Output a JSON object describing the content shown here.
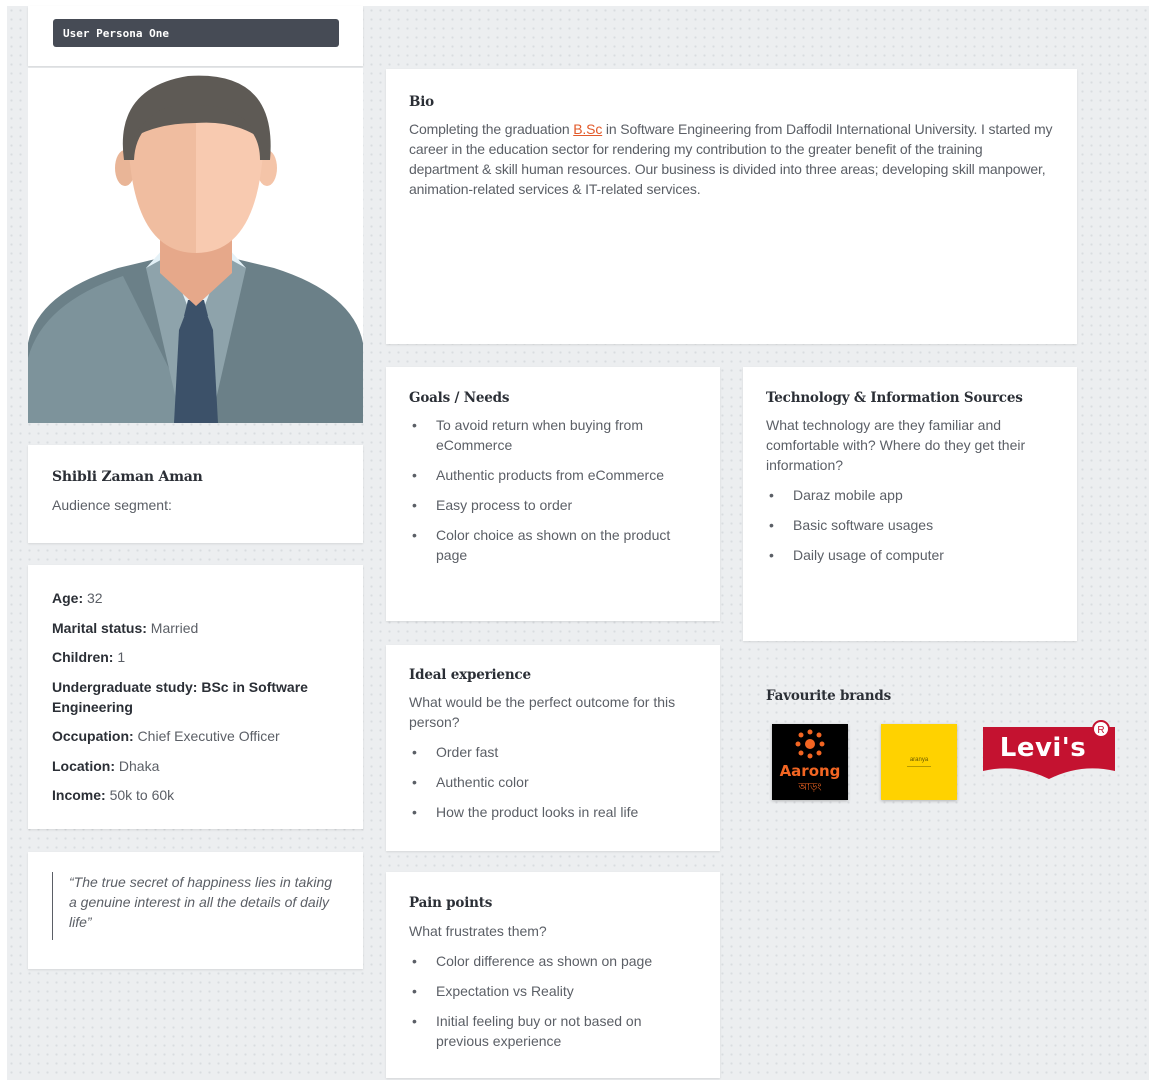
{
  "header": {
    "title": "User Persona One"
  },
  "bio": {
    "title": "Bio",
    "text_before": "Completing the graduation ",
    "link": "B.Sc",
    "text_after": " in Software Engineering from Daffodil International University. I started my career in the education sector for rendering my contribution to the greater benefit of the training department & skill human resources. Our business is divided into three areas; developing skill manpower, animation-related services & IT-related services."
  },
  "persona": {
    "name": "Shibli Zaman Aman",
    "segment": "Audience segment:"
  },
  "details": {
    "age_label": "Age:",
    "age": " 32",
    "marital_label": "Marital status:",
    "marital": " Married",
    "children_label": "Children:",
    "children": " 1",
    "undergrad_label": "Undergraduate study: BSc in Software Engineering",
    "occupation_label": "Occupation:",
    "occupation": " Chief Executive Officer",
    "location_label": "Location:",
    "location": " Dhaka",
    "income_label": "Income:",
    "income": " 50k to 60k"
  },
  "quote": "“The true secret of happiness lies in taking a genuine interest in all the details of daily life”",
  "goals": {
    "title": "Goals / Needs",
    "items": [
      "To avoid return when buying  from eCommerce",
      "Authentic products from eCommerce",
      "Easy process to order",
      "Color choice as shown on the product page"
    ]
  },
  "technology": {
    "title": "Technology & Information Sources",
    "intro": "What technology are they familiar and comfortable with? Where do they get their information?",
    "items": [
      "Daraz mobile app",
      "Basic software usages",
      "Daily usage of computer"
    ]
  },
  "ideal": {
    "title": "Ideal experience",
    "intro": "What would be the perfect outcome for this person?",
    "items": [
      "Order fast",
      "Authentic color",
      "How the product looks in real life"
    ]
  },
  "pain": {
    "title": "Pain points",
    "intro": "What frustrates them?",
    "items": [
      "Color difference as shown on page",
      "Expectation vs Reality",
      "Initial feeling buy or not based on previous experience"
    ]
  },
  "brands": {
    "title": "Favourite brands",
    "items": [
      {
        "text": "Aarong",
        "subtext": "আড়ং",
        "icon": "aarong-logo",
        "bg": "#000000",
        "fg": "#f26522"
      },
      {
        "text": "aranya",
        "icon": "aranya-logo",
        "bg": "#ffd200",
        "fg": "#6b5a00"
      },
      {
        "text": "Levi's",
        "icon": "levis-logo",
        "bg": "#c41230",
        "fg": "#ffffff"
      }
    ]
  },
  "colors": {
    "board": "#eceef0",
    "pill": "#464b55",
    "link": "#e25a2a",
    "title": "#2b2f36",
    "body": "#5b5f66"
  }
}
